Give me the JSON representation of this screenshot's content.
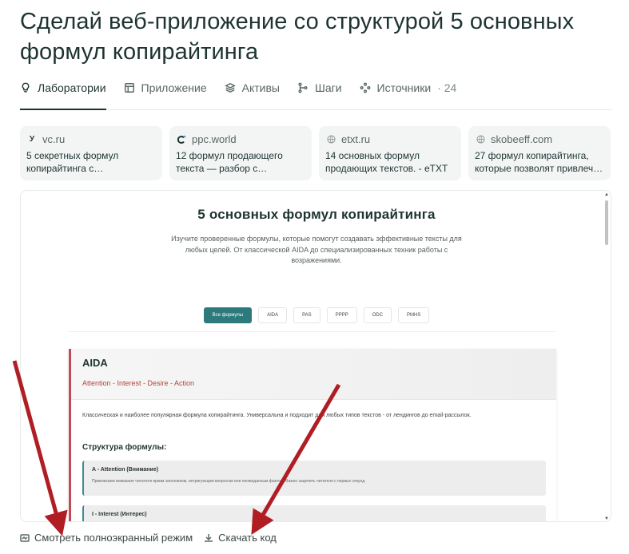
{
  "title": "Сделай веб-приложение со структурой 5 основных формул копирайтинга",
  "tabs": [
    {
      "label": "Лаборатории",
      "icon": "lightbulb-icon"
    },
    {
      "label": "Приложение",
      "icon": "app-window-icon"
    },
    {
      "label": "Активы",
      "icon": "layers-icon"
    },
    {
      "label": "Шаги",
      "icon": "steps-icon"
    },
    {
      "label": "Источники",
      "icon": "sources-icon",
      "count": "· 24"
    }
  ],
  "sources": [
    {
      "site": "vc.ru",
      "text": "5 секретных формул копирайтинга с примерами…"
    },
    {
      "site": "ppc.world",
      "text": "12 формул продающего текста — разбор с…"
    },
    {
      "site": "etxt.ru",
      "text": "14 основных формул продающих текстов. - eTXT"
    },
    {
      "site": "skobeeff.com",
      "text": "27 формул копирайтинга, которые позволят привлеч…"
    }
  ],
  "preview": {
    "title": "5 основных формул копирайтинга",
    "subtitle": "Изучите проверенные формулы, которые помогут создавать эффективные тексты для любых целей. От классической AIDA до специализированных техник работы с возражениями.",
    "filters": [
      "Все формулы",
      "AIDA",
      "PAS",
      "PPPP",
      "ODC",
      "PMHS"
    ],
    "card": {
      "name": "AIDA",
      "subtitle": "Attention - Interest - Desire - Action",
      "description": "Классическая и наиболее популярная формула копирайтинга. Универсальна и подходит для любых типов текстов - от лендингов до email-рассылок.",
      "structure_label": "Структура формулы:",
      "steps": [
        {
          "title": "A - Attention (Внимание)",
          "text": "Привлекаем внимание читателя ярким заголовком, интригующим вопросом или неожиданным фактом. Важно зацепить читателя с первых секунд."
        },
        {
          "title": "I - Interest (Интерес)",
          "text": ""
        }
      ]
    }
  },
  "bottom": {
    "fullscreen_label": "Смотреть полноэкранный режим",
    "download_label": "Скачать код"
  },
  "colors": {
    "accent": "#2c7a7b",
    "card_border": "#c04a55",
    "arrow": "#b01e24"
  }
}
